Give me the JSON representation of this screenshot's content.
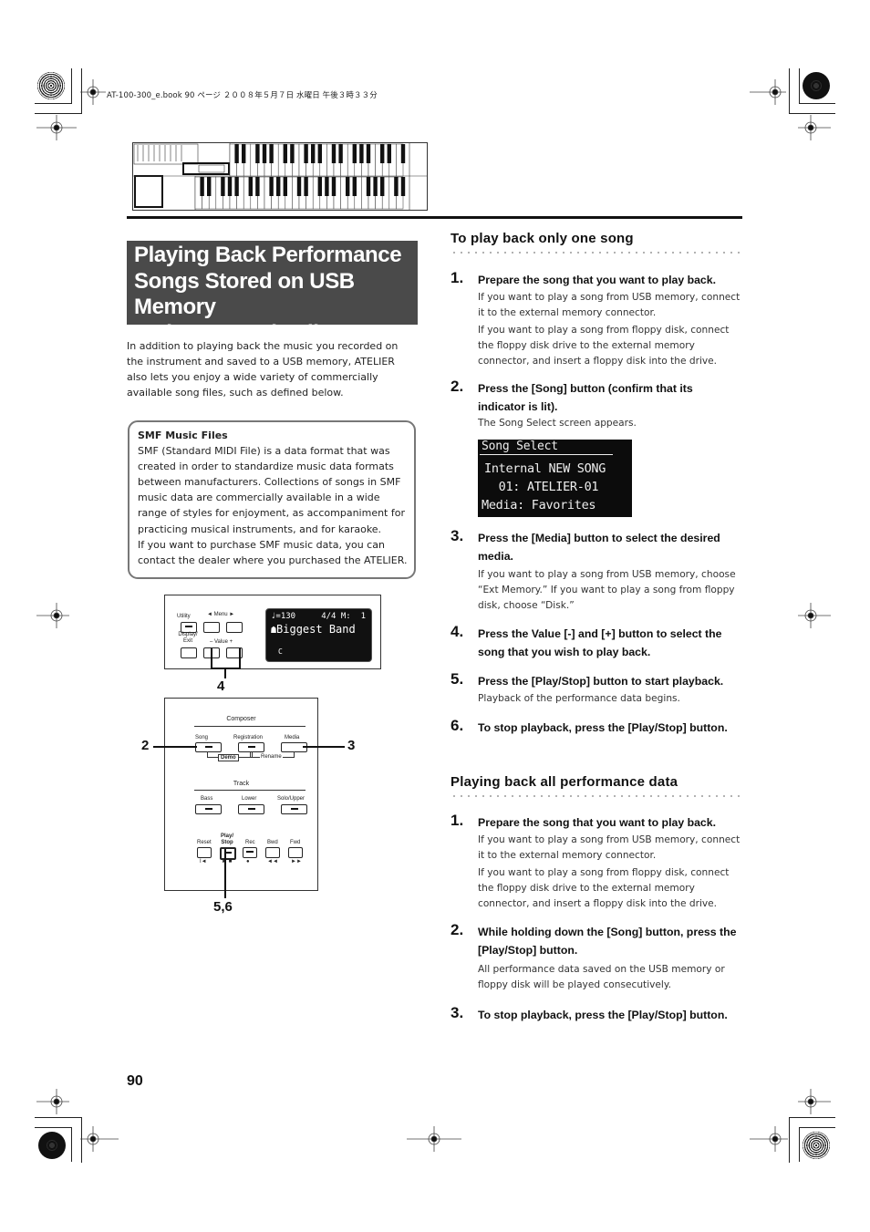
{
  "header": {
    "print_info": "AT-100-300_e.book  90 ページ  ２００８年５月７日  水曜日  午後３時３３分"
  },
  "title": "Playing Back Performance Songs Stored on USB Memory and SMF Music Files",
  "title_lines": [
    "Playing Back Performance",
    "Songs Stored on USB Memory",
    "and SMF Music Files"
  ],
  "intro": "In addition to playing back the music you recorded on the instrument and saved to a USB memory, ATELIER also lets you enjoy a wide variety of commercially available song files, such as defined below.",
  "note": {
    "title": "SMF Music Files",
    "paragraphs": [
      "SMF (Standard MIDI File) is a data format that was created in order to standardize music data formats between manufacturers. Collections of songs in SMF music data are commercially available in a wide range of styles for enjoyment, as accompaniment for practicing musical instruments, and for karaoke.",
      "If you want to purchase SMF music data, you can contact the dealer where you purchased the ATELIER."
    ]
  },
  "panel1": {
    "labels": {
      "utility": "Utility",
      "menu": "◄ Menu ►",
      "display_exit": "Display/ Exit",
      "value": "– Value +"
    },
    "lcd": {
      "line1_left": "♩=130",
      "line1_right": "4/4 M:  1",
      "line2": "Biggest Band",
      "line3": "C"
    },
    "callout": "4"
  },
  "panel2": {
    "composer_label": "Composer",
    "track_label": "Track",
    "composer_buttons": [
      "Song",
      "Registration",
      "Media"
    ],
    "demo_label": "Demo",
    "rename_label": "Rename",
    "track_buttons": [
      "Bass",
      "Lower",
      "Solo/Upper"
    ],
    "transport_buttons": [
      "Reset",
      "Play/ Stop",
      "Rec",
      "Bwd",
      "Fwd"
    ],
    "transport_symbols": [
      "I◄",
      "► ■",
      "●",
      "◄◄",
      "►►"
    ],
    "callouts": {
      "song": "2",
      "media": "3",
      "play_stop": "5,6"
    }
  },
  "section1": {
    "title": "To play back only one song",
    "steps": [
      {
        "num": "1.",
        "head": "Prepare the song that you want to play back.",
        "body": [
          "If you want to play a song from USB memory, connect it to the external memory connector.",
          "If you want to play a song from floppy disk, connect the floppy disk drive to the external memory connector, and insert a floppy disk into the drive."
        ]
      },
      {
        "num": "2.",
        "head": "Press the [Song] button (confirm that its indicator is lit).",
        "body": [
          "The Song Select screen appears."
        ]
      },
      {
        "num": "3.",
        "head": "Press the [Media] button to select the desired media.",
        "body": [
          "If you want to play a song from USB memory, choose “Ext Memory.” If you want to play a song from floppy disk, choose “Disk.”"
        ]
      },
      {
        "num": "4.",
        "head": "Press the Value [-] and [+] button to select the song that you wish to play back.",
        "body": []
      },
      {
        "num": "5.",
        "head": "Press the [Play/Stop] button to start playback.",
        "body": [
          "Playback of the performance data begins."
        ]
      },
      {
        "num": "6.",
        "head": "To stop playback, press the [Play/Stop] button.",
        "body": []
      }
    ]
  },
  "song_select_screen": {
    "title": "Song Select",
    "line1": "Internal NEW SONG",
    "line2": "  01: ATELIER-01",
    "line3": "Media: Favorites"
  },
  "section2": {
    "title": "Playing back all performance data",
    "steps": [
      {
        "num": "1.",
        "head": "Prepare the song that you want to play back.",
        "body": [
          "If you want to play a song from USB memory, connect it to the external memory connector.",
          "If you want to play a song from floppy disk, connect the floppy disk drive to the external memory connector, and insert a floppy disk into the drive."
        ]
      },
      {
        "num": "2.",
        "head": "While holding down the [Song] button, press the [Play/Stop] button.",
        "body": [
          "All performance data saved on the USB memory or floppy disk will be played consecutively."
        ]
      },
      {
        "num": "3.",
        "head": "To stop playback, press the [Play/Stop] button.",
        "body": []
      }
    ]
  },
  "page_number": "90"
}
